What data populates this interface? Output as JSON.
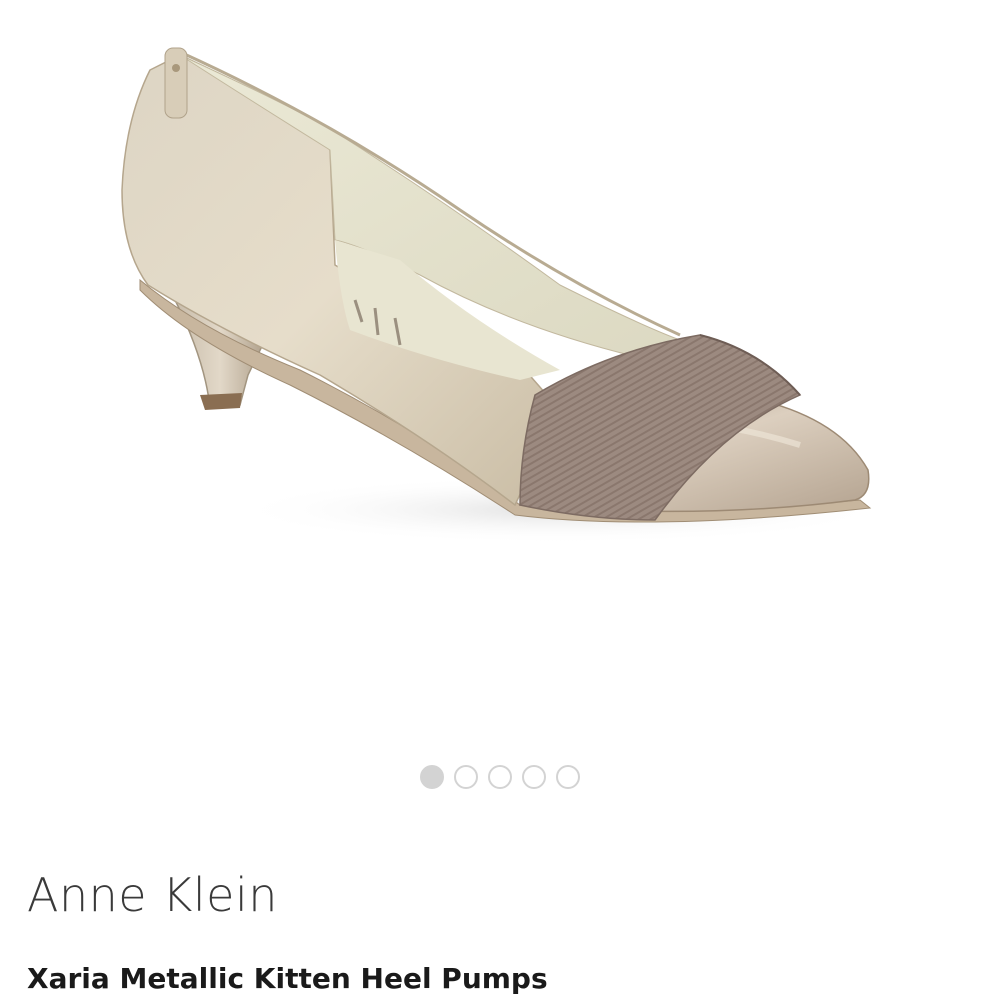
{
  "product": {
    "brand": "Anne Klein",
    "name": "Xaria Metallic Kitten Heel Pumps",
    "image_alt": "Metallic kitten heel pump"
  },
  "carousel": {
    "total": 5,
    "active_index": 0,
    "active_color": "#d3d3d3",
    "inactive_border": "#d3d3d3"
  }
}
